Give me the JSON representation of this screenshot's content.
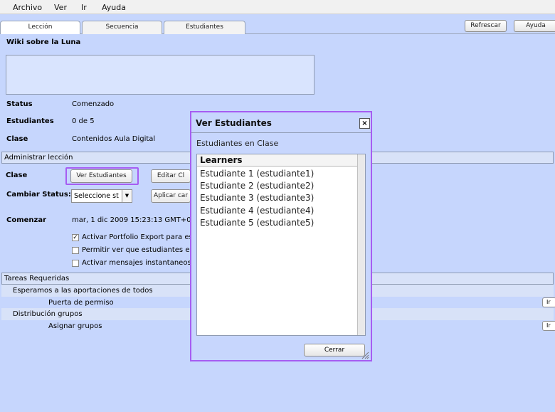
{
  "menu": {
    "items": [
      {
        "label": "Archivo"
      },
      {
        "label": "Ver"
      },
      {
        "label": "Ir"
      },
      {
        "label": "Ayuda"
      }
    ]
  },
  "tabs": [
    {
      "label": "Lección",
      "active": true
    },
    {
      "label": "Secuencia",
      "active": false
    },
    {
      "label": "Estudiantes",
      "active": false
    }
  ],
  "toolbar": {
    "refresh_label": "Refrescar",
    "help_label": "Ayuda"
  },
  "lesson": {
    "title": "Wiki sobre la Luna",
    "status_label": "Status",
    "status_value": "Comenzado",
    "students_label": "Estudiantes",
    "students_value": "0 de 5",
    "class_label": "Clase",
    "class_value": "Contenidos Aula Digital"
  },
  "admin": {
    "section_title": "Administrar lección",
    "class_label": "Clase",
    "view_students_button": "Ver Estudiantes",
    "edit_class_button": "Editar Cl",
    "change_status_label": "Cambiar Status:",
    "status_select_value": "Seleccione st",
    "apply_button": "Aplicar car",
    "start_label": "Comenzar",
    "start_value": "mar, 1 dic 2009 15:23:13 GMT+01:0",
    "options": [
      {
        "label": "Activar Portfolio Export para estu",
        "checked": true
      },
      {
        "label": "Permitir ver que estudiantes est",
        "checked": false
      },
      {
        "label": "Activar mensajes instantaneos",
        "checked": false
      }
    ]
  },
  "tasks": {
    "section_title": "Tareas Requeridas",
    "rows": [
      {
        "label": "Esperamos a las aportaciones de todos",
        "level": 1,
        "button": ""
      },
      {
        "label": "Puerta de permiso",
        "level": 2,
        "button": "Ir"
      },
      {
        "label": "Distribución grupos",
        "level": 1,
        "button": ""
      },
      {
        "label": "Asignar grupos",
        "level": 2,
        "button": "Ir"
      }
    ]
  },
  "dialog": {
    "title": "Ver Estudiantes",
    "close_glyph": "×",
    "subtitle": "Estudiantes en Clase",
    "list_header": "Learners",
    "learners": [
      "Estudiante 1 (estudiante1)",
      "Estudiante 2 (estudiante2)",
      "Estudiante 3 (estudiante3)",
      "Estudiante 4 (estudiante4)",
      "Estudiante 5 (estudiante5)"
    ],
    "close_button": "Cerrar"
  },
  "colors": {
    "background": "#c6d6fd",
    "highlight": "#a65df2",
    "section": "#d8e2f8"
  }
}
